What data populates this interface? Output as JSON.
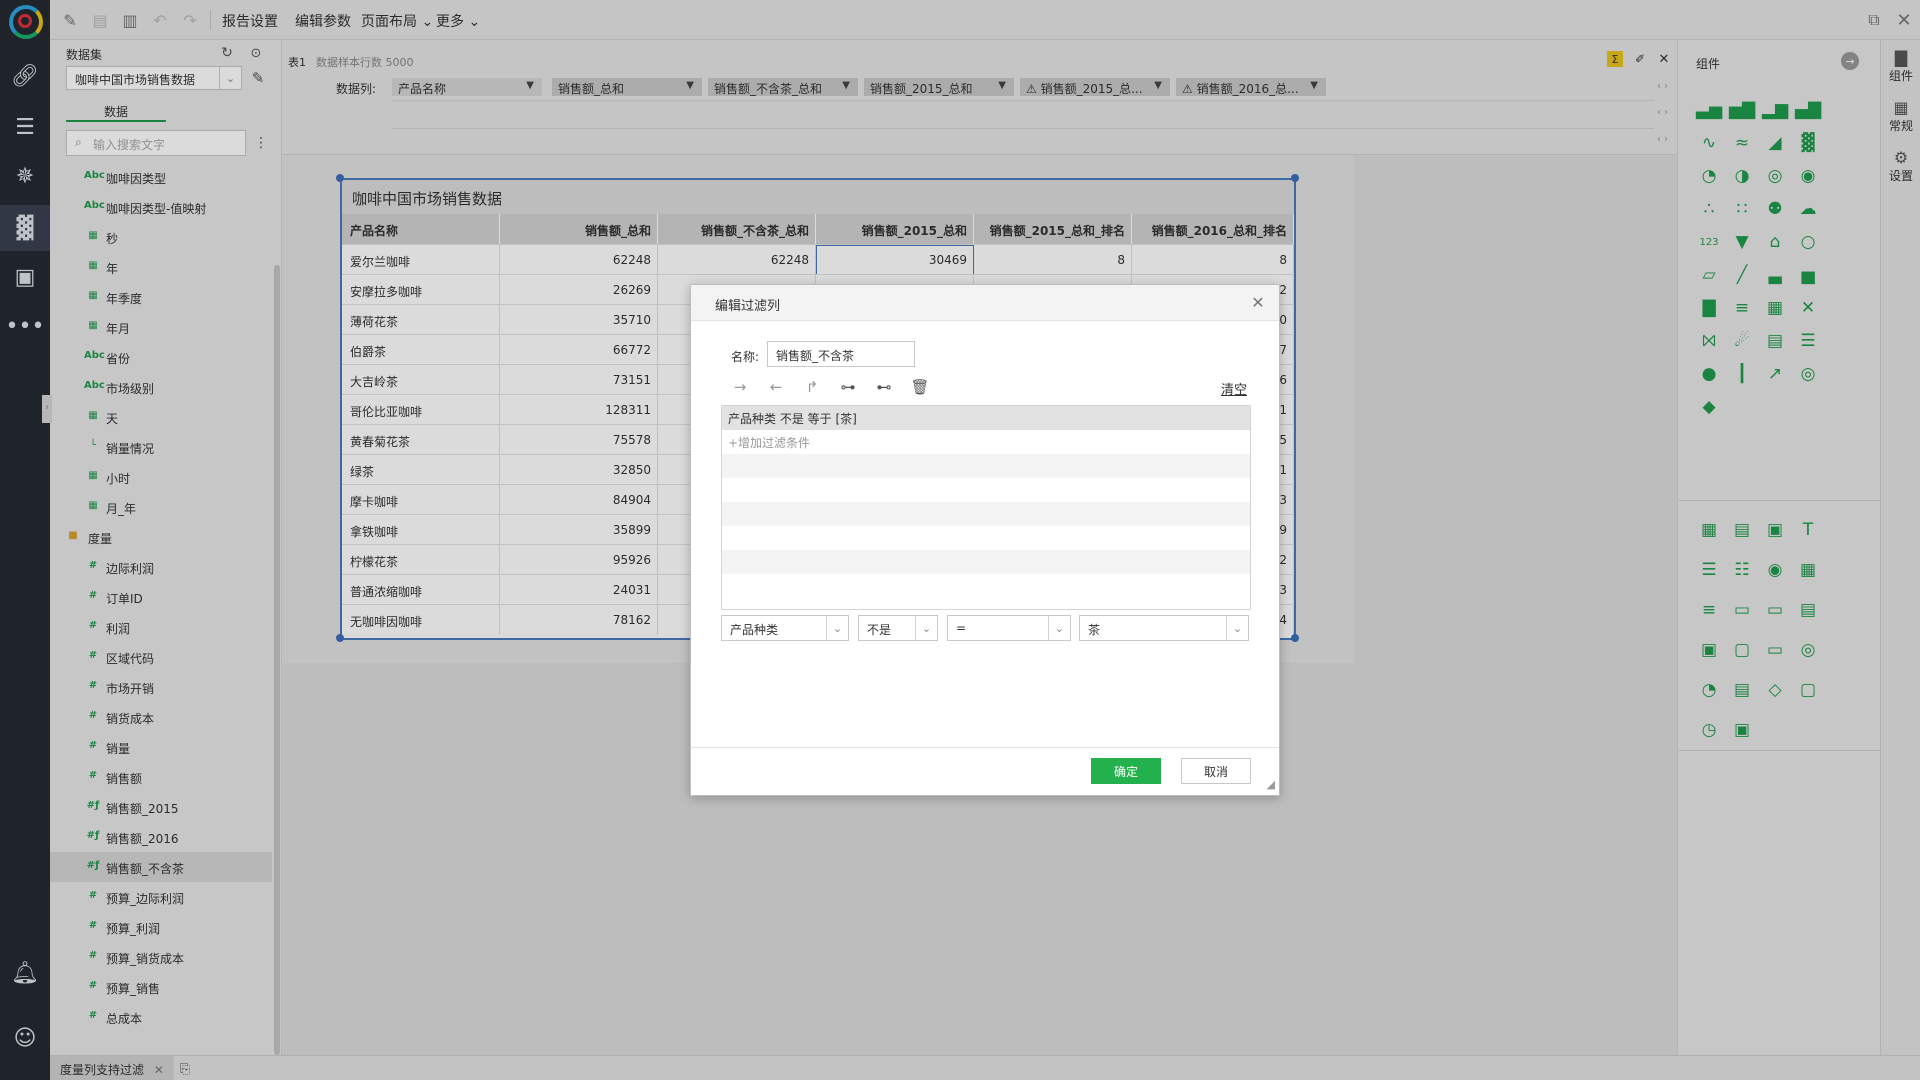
{
  "toolbar": {
    "report_settings": "报告设置",
    "edit_params": "编辑参数",
    "page_layout": "页面布局",
    "more": "更多"
  },
  "dataset_panel": {
    "title": "数据集",
    "dataset_name": "咖啡中国市场销售数据",
    "tab_data": "数据",
    "search_placeholder": "输入搜索文字",
    "fields": [
      {
        "icon": "Abc",
        "label": "咖啡因类型"
      },
      {
        "icon": "Abc",
        "label": "咖啡因类型-值映射"
      },
      {
        "icon": "calendar",
        "label": "秒"
      },
      {
        "icon": "calendar",
        "label": "年"
      },
      {
        "icon": "calendar",
        "label": "年季度"
      },
      {
        "icon": "calendar",
        "label": "年月"
      },
      {
        "icon": "Abc",
        "label": "省份"
      },
      {
        "icon": "Abc",
        "label": "市场级别"
      },
      {
        "icon": "calendar",
        "label": "天"
      },
      {
        "icon": "hierarchy",
        "label": "销量情况"
      },
      {
        "icon": "calendar",
        "label": "小时"
      },
      {
        "icon": "calendar",
        "label": "月_年"
      },
      {
        "icon": "folder",
        "label": "度量"
      },
      {
        "icon": "#",
        "label": "边际利润"
      },
      {
        "icon": "#",
        "label": "订单ID"
      },
      {
        "icon": "#",
        "label": "利润"
      },
      {
        "icon": "#",
        "label": "区域代码"
      },
      {
        "icon": "#",
        "label": "市场开销"
      },
      {
        "icon": "#",
        "label": "销货成本"
      },
      {
        "icon": "#",
        "label": "销量"
      },
      {
        "icon": "#",
        "label": "销售额"
      },
      {
        "icon": "#f",
        "label": "销售额_2015"
      },
      {
        "icon": "#f",
        "label": "销售额_2016"
      },
      {
        "icon": "#f",
        "label": "销售额_不含茶"
      },
      {
        "icon": "#",
        "label": "预算_边际利润"
      },
      {
        "icon": "#",
        "label": "预算_利润"
      },
      {
        "icon": "#",
        "label": "预算_销货成本"
      },
      {
        "icon": "#",
        "label": "预算_销售"
      },
      {
        "icon": "#",
        "label": "总成本"
      }
    ]
  },
  "data_columns_bar": {
    "table_label": "表1",
    "row_count_text": "数据样本行数 5000",
    "columns_label": "数据列:",
    "chips": [
      "产品名称",
      "销售额_总和",
      "销售额_不含茶_总和",
      "销售额_2015_总和",
      "销售额_2015_总...",
      "销售额_2016_总..."
    ]
  },
  "table": {
    "title": "咖啡中国市场销售数据",
    "headers": [
      "产品名称",
      "销售额_总和",
      "销售额_不含茶_总和",
      "销售额_2015_总和",
      "销售额_2015_总和_排名",
      "销售额_2016_总和_排名"
    ],
    "rows": [
      [
        "爱尔兰咖啡",
        "62248",
        "62248",
        "30469",
        "8",
        "8"
      ],
      [
        "安摩拉多咖啡",
        "26269",
        "",
        "",
        "",
        "2"
      ],
      [
        "薄荷花茶",
        "35710",
        "",
        "",
        "",
        "0"
      ],
      [
        "伯爵茶",
        "66772",
        "",
        "",
        "",
        "7"
      ],
      [
        "大吉岭茶",
        "73151",
        "",
        "",
        "",
        "6"
      ],
      [
        "哥伦比亚咖啡",
        "128311",
        "",
        "",
        "",
        "1"
      ],
      [
        "黄春菊花茶",
        "75578",
        "",
        "",
        "",
        "5"
      ],
      [
        "绿茶",
        "32850",
        "",
        "",
        "",
        "1"
      ],
      [
        "摩卡咖啡",
        "84904",
        "",
        "",
        "",
        "3"
      ],
      [
        "拿铁咖啡",
        "35899",
        "",
        "",
        "",
        "9"
      ],
      [
        "柠檬花茶",
        "95926",
        "",
        "",
        "",
        "2"
      ],
      [
        "普通浓缩咖啡",
        "24031",
        "",
        "",
        "",
        "3"
      ],
      [
        "无咖啡因咖啡",
        "78162",
        "",
        "",
        "",
        "4"
      ]
    ]
  },
  "right_panel": {
    "title": "组件"
  },
  "right_nav": {
    "components": "组件",
    "general": "常规",
    "settings": "设置"
  },
  "bottom_tab": {
    "label": "度量列支持过滤"
  },
  "dialog": {
    "title": "编辑过滤列",
    "name_label": "名称:",
    "name_value": "销售额_不含茶",
    "clear": "清空",
    "conditions": [
      "产品种类 不是 等于 [茶]"
    ],
    "add_condition": "+增加过滤条件",
    "field_select": "产品种类",
    "negate_select": "不是",
    "operator_select": "=",
    "value_select": "茶",
    "ok": "确定",
    "cancel": "取消"
  },
  "colors": {
    "accent": "#22b14c",
    "nav_bg": "#252a33",
    "selection_blue": "#4a7bc0"
  }
}
